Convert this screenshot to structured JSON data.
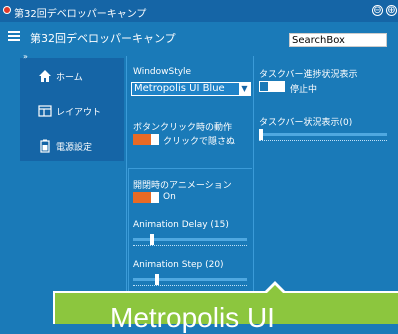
{
  "titlebar": {
    "title": "第32回デベロッパーキャンプ",
    "minimize_glyph": "⊖",
    "maximize_glyph": "⊕"
  },
  "header": {
    "app_name": "第32回デベロッパーキャンプ",
    "search_value": "SearchBox"
  },
  "sidebar": {
    "collapse_glyph": "»",
    "items": [
      {
        "label": "ホーム",
        "icon": "home-icon"
      },
      {
        "label": "レイアウト",
        "icon": "layout-icon"
      },
      {
        "label": "電源設定",
        "icon": "battery-icon"
      }
    ]
  },
  "settings": {
    "window_style_label": "WindowStyle",
    "window_style_value": "Metropolis UI Blue",
    "button_click_label": "ボタンクリック時の動作",
    "button_click_toggle_text": "クリックで隠さぬ",
    "open_close_anim_label": "開閉時のアニメーション",
    "open_close_anim_toggle_text": "On",
    "anim_delay_label": "Animation Delay (15)",
    "anim_delay_level": 0.15,
    "anim_step_label": "Animation Step (20)",
    "anim_step_level": 0.2,
    "taskbar_progress_label": "タスクバー進捗状況表示",
    "taskbar_progress_toggle_text": "停止中",
    "taskbar_status_label": "タスクバー状況表示(0)",
    "taskbar_status_level": 0
  },
  "banner": {
    "text": "Metropolis UI"
  },
  "colors": {
    "background": "#1a7ab8",
    "titlebar": "#1565a6",
    "accent_toggle": "#e86a25",
    "banner": "#8cc63e"
  }
}
